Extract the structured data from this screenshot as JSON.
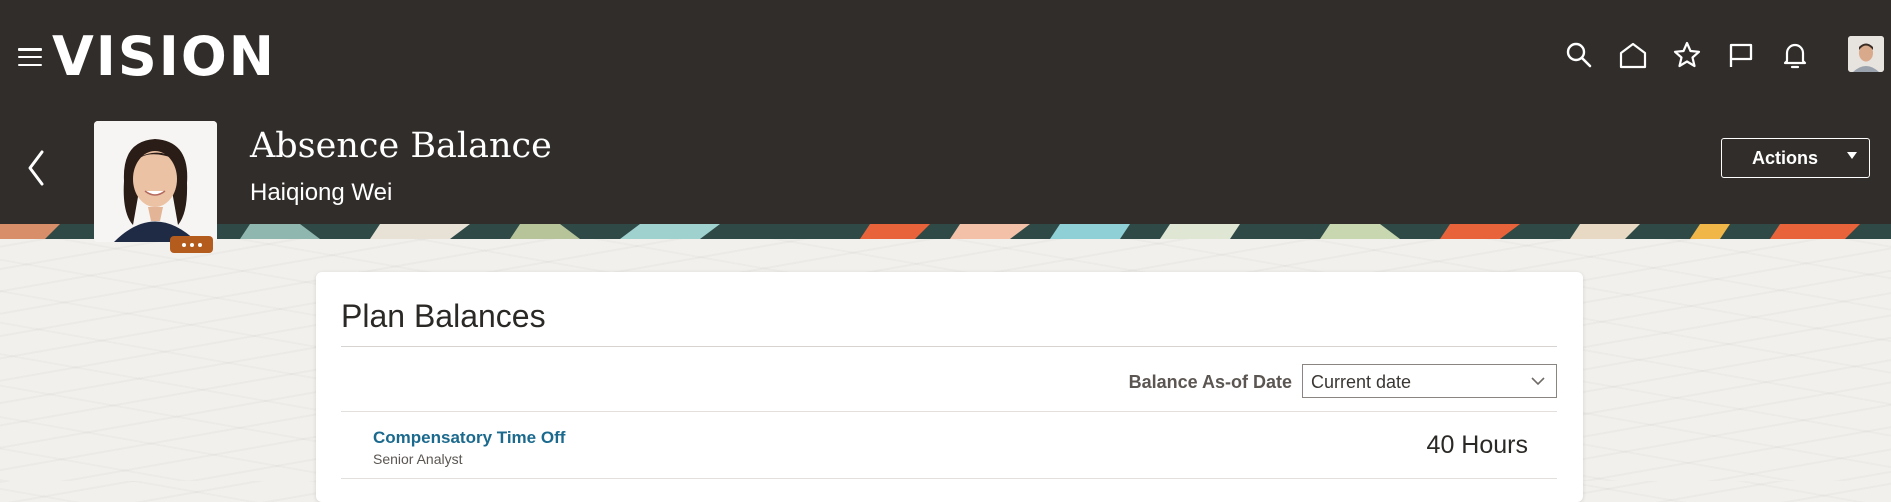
{
  "header": {
    "logo": "VISION",
    "icons": [
      "menu-icon",
      "search-icon",
      "home-icon",
      "star-icon",
      "flag-icon",
      "bell-icon"
    ],
    "title": "Absence Balance",
    "person_name": "Haiqiong Wei",
    "actions_label": "Actions"
  },
  "card": {
    "title": "Plan Balances",
    "as_of_label": "Balance As-of Date",
    "as_of_value": "Current date",
    "plans": [
      {
        "name": "Compensatory Time Off",
        "subtitle": "Senior Analyst",
        "balance": "40 Hours"
      }
    ]
  },
  "colors": {
    "header_bg": "#312d2a",
    "link": "#1b6a8e",
    "badge": "#b45c1d"
  }
}
